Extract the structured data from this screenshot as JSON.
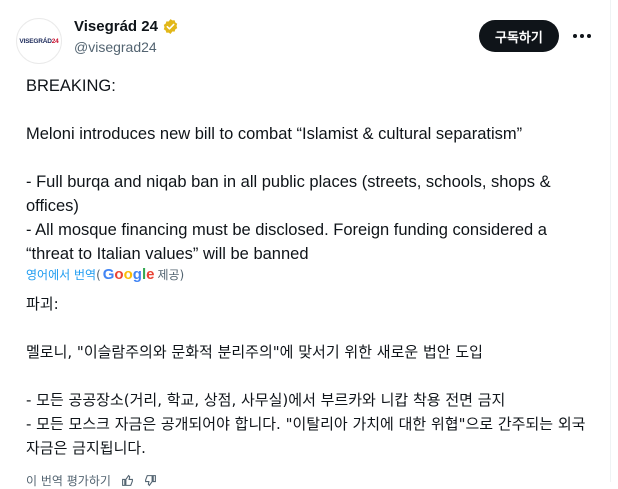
{
  "author": {
    "avatar_text_a": "VISEGRÁD",
    "avatar_text_b": "24",
    "name": "Visegrád 24",
    "handle": "@visegrad24",
    "badge_color": "#e2b719"
  },
  "actions": {
    "follow_label": "구독하기",
    "more_icon": "more-horizontal-icon"
  },
  "tweet": {
    "breaking": "BREAKING:",
    "headline": "Meloni introduces new bill to combat “Islamist & cultural separatism”",
    "bullet_1": "- Full burqa and niqab ban in all public places (streets, schools, shops & offices)",
    "bullet_2": "- All mosque financing must be disclosed. Foreign funding considered a “threat to Italian values” will be banned"
  },
  "translation": {
    "link_label": "영어에서 번역",
    "paren_open": "(",
    "provider": "Google",
    "suffix": "제공)",
    "breaking": "파괴:",
    "headline": "멜로니, \"이슬람주의와 문화적 분리주의\"에 맞서기 위한 새로운 법안 도입",
    "bullet_1": "- 모든 공공장소(거리, 학교, 상점, 사무실)에서 부르카와 니캅 착용 전면 금지",
    "bullet_2": "- 모든 모스크 자금은 공개되어야 합니다. \"이탈리아 가치에 대한 위협\"으로 간주되는 외국 자금은 금지됩니다."
  },
  "footer": {
    "rate_label": "이 번역 평가하기"
  },
  "colors": {
    "text": "#0f1419",
    "secondary": "#536471",
    "link": "#1d9bf0",
    "button_bg": "#0f1419"
  }
}
